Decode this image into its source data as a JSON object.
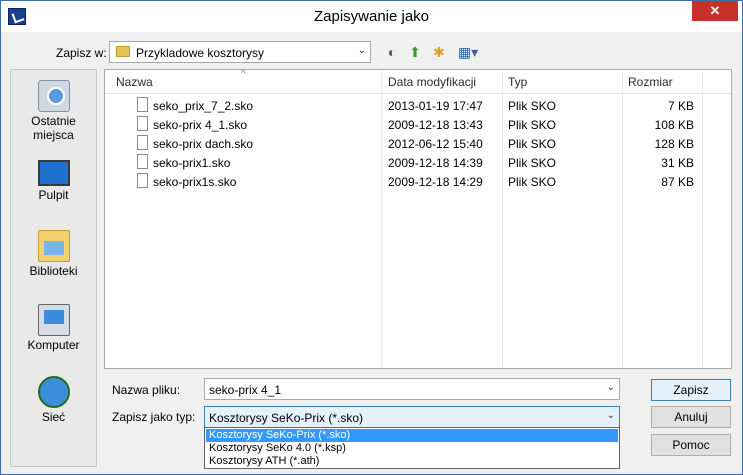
{
  "window": {
    "title": "Zapisywanie jako",
    "close_glyph": "✕",
    "title_icon": "app-icon"
  },
  "lookin": {
    "label": "Zapisz w:",
    "value": "Przykladowe kosztorysy",
    "arrow": "⌄"
  },
  "toolbar": {
    "back_glyph": "◐",
    "up_glyph": "⬆",
    "newfolder_glyph": "✱",
    "views_glyph": "▦▾"
  },
  "places": [
    {
      "label_line1": "Ostatnie",
      "label_line2": "miejsca",
      "icon": "recent-places-icon"
    },
    {
      "label_line1": "Pulpit",
      "label_line2": "",
      "icon": "desktop-icon"
    },
    {
      "label_line1": "Biblioteki",
      "label_line2": "",
      "icon": "libraries-icon"
    },
    {
      "label_line1": "Komputer",
      "label_line2": "",
      "icon": "computer-icon"
    },
    {
      "label_line1": "Sieć",
      "label_line2": "",
      "icon": "network-icon"
    }
  ],
  "columns": {
    "name": "Nazwa",
    "date": "Data modyfikacji",
    "type": "Typ",
    "size": "Rozmiar"
  },
  "files": [
    {
      "name": "seko_prix_7_2.sko",
      "date": "2013-01-19 17:47",
      "type": "Plik SKO",
      "size": "7 KB"
    },
    {
      "name": "seko-prix 4_1.sko",
      "date": "2009-12-18 13:43",
      "type": "Plik SKO",
      "size": "108 KB"
    },
    {
      "name": "seko-prix dach.sko",
      "date": "2012-06-12 15:40",
      "type": "Plik SKO",
      "size": "128 KB"
    },
    {
      "name": "seko-prix1.sko",
      "date": "2009-12-18 14:39",
      "type": "Plik SKO",
      "size": "31 KB"
    },
    {
      "name": "seko-prix1s.sko",
      "date": "2009-12-18 14:29",
      "type": "Plik SKO",
      "size": "87 KB"
    }
  ],
  "filename": {
    "label": "Nazwa pliku:",
    "value": "seko-prix 4_1",
    "arrow": "⌄"
  },
  "filetype": {
    "label": "Zapisz jako typ:",
    "value": "Kosztorysy SeKo-Prix (*.sko)",
    "arrow": "⌄",
    "options": [
      "Kosztorysy SeKo-Prix (*.sko)",
      "Kosztorysy SeKo 4.0 (*.ksp)",
      "Kosztorysy ATH (*.ath)"
    ],
    "selected_index": 0
  },
  "buttons": {
    "save": "Zapisz",
    "cancel": "Anuluj",
    "help": "Pomoc"
  },
  "colors": {
    "accent": "#3399ff",
    "close": "#c7302b"
  }
}
